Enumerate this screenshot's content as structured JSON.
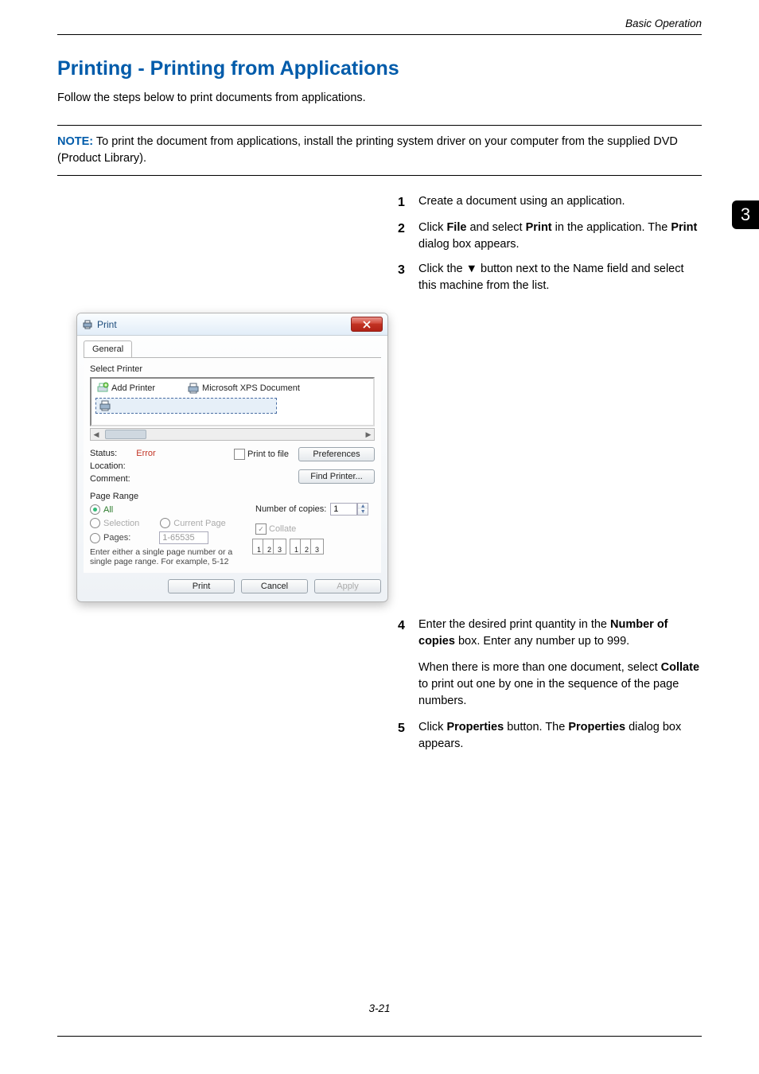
{
  "header": {
    "right": "Basic Operation"
  },
  "tab": {
    "label": "3"
  },
  "title": "Printing - Printing from Applications",
  "intro": "Follow the steps below to print documents from applications.",
  "note": {
    "label": "NOTE:",
    "text": " To print the document from applications, install the printing system driver on your computer from the supplied DVD (Product Library)."
  },
  "steps": {
    "s1": {
      "num": "1",
      "t1": "Create a document using an application."
    },
    "s2": {
      "num": "2",
      "t1": "Click ",
      "b1": "File",
      "t2": " and select ",
      "b2": "Print",
      "t3": " in the application. The ",
      "b3": "Print",
      "t4": " dialog box appears."
    },
    "s3": {
      "num": "3",
      "t1": "Click the ▼ button next to the Name field and select this machine from the list."
    },
    "s4": {
      "num": "4",
      "t1": "Enter the desired print quantity in the ",
      "b1": "Number of copies",
      "t2": " box. Enter any number up to 999."
    },
    "s4p": {
      "t1": "When there is more than one document, select ",
      "b1": "Collate",
      "t2": " to print out one by one in the sequence of the page numbers."
    },
    "s5": {
      "num": "5",
      "t1": "Click ",
      "b1": "Properties",
      "t2": " button. The ",
      "b2": "Properties",
      "t3": " dialog box appears."
    }
  },
  "dialog": {
    "title": "Print",
    "tab_general": "General",
    "select_printer": "Select Printer",
    "add_printer": "Add Printer",
    "xps": "Microsoft XPS Document",
    "status_lbl": "Status:",
    "status_err": "Error",
    "location_lbl": "Location:",
    "comment_lbl": "Comment:",
    "print_to_file": "Print to file",
    "preferences": "Preferences",
    "find_printer": "Find Printer...",
    "page_range": "Page Range",
    "all": "All",
    "selection": "Selection",
    "current_page": "Current Page",
    "pages": "Pages:",
    "pages_value": "1-65535",
    "pages_hint": "Enter either a single page number or a single page range. For example, 5-12",
    "copies_lbl": "Number of copies:",
    "copies_value": "1",
    "collate": "Collate",
    "btn_print": "Print",
    "btn_cancel": "Cancel",
    "btn_apply": "Apply"
  },
  "footer": {
    "page": "3-21"
  }
}
